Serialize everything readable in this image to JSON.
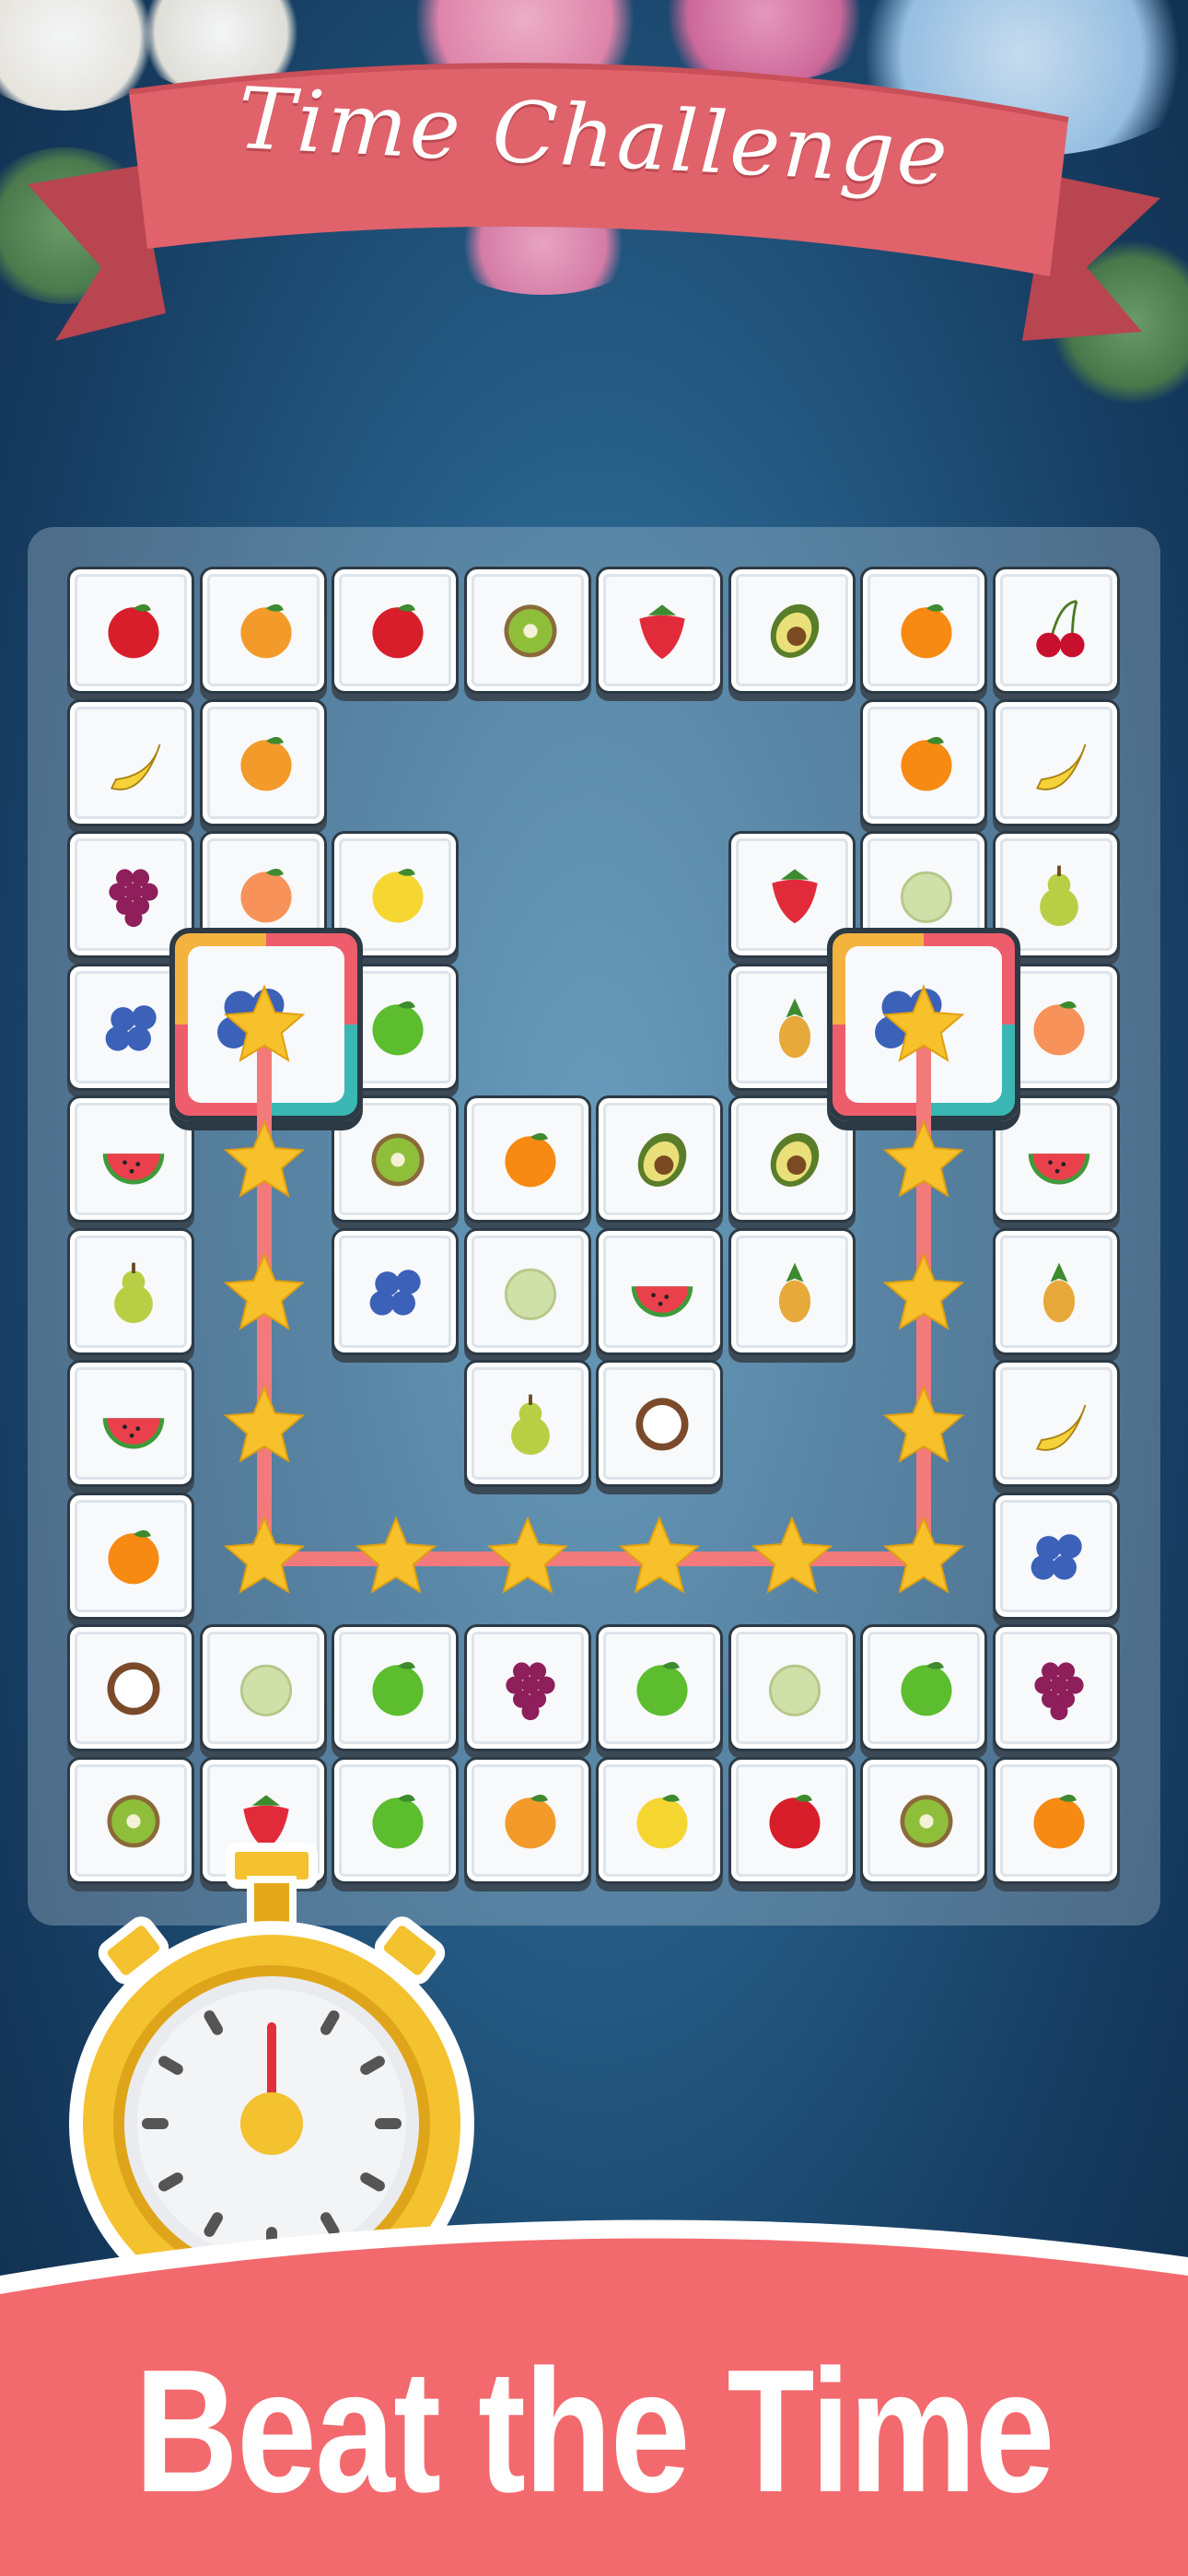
{
  "banner": {
    "title": "Time Challenge",
    "color": "#e0636b"
  },
  "tagline": {
    "text": "Beat the Time",
    "band_color": "#f26a6e"
  },
  "palette": {
    "path": "#f27a7a",
    "star": "#f6c12b",
    "timer": "#f4c12f"
  },
  "board": {
    "rows": [
      [
        "apple",
        "mango",
        "apple",
        "kiwi",
        "strawberry",
        "avocado",
        "orange",
        "cherry"
      ],
      [
        "banana",
        "mango",
        null,
        null,
        null,
        null,
        "orange",
        "banana"
      ],
      [
        "grapes",
        "peach",
        "lemon",
        null,
        null,
        "strawberry",
        "melon",
        "pear"
      ],
      [
        "blueberry",
        "blueberry",
        "apple-green",
        null,
        null,
        "pineapple",
        "blueberry",
        "peach"
      ],
      [
        "watermelon",
        null,
        "kiwi",
        "orange",
        "avocado",
        "avocado",
        null,
        "watermelon"
      ],
      [
        "pear",
        null,
        "blueberry",
        "melon",
        "watermelon",
        "pineapple",
        null,
        "pineapple"
      ],
      [
        "watermelon",
        null,
        null,
        "pear",
        "coconut",
        null,
        null,
        "banana"
      ],
      [
        "orange",
        null,
        null,
        null,
        null,
        null,
        null,
        "blueberry"
      ],
      [
        "coconut",
        "melon",
        "apple-green",
        "grapes",
        "apple-green",
        "melon",
        "apple-green",
        "grapes"
      ],
      [
        "kiwi",
        "strawberry",
        "apple-green",
        "mango",
        "lemon",
        "apple",
        "kiwi",
        "orange"
      ]
    ],
    "selected": [
      {
        "fruit": "blueberry",
        "row": 3,
        "col": 1
      },
      {
        "fruit": "blueberry",
        "row": 3,
        "col": 6
      }
    ]
  },
  "fruit_colors": {
    "apple": "#d81e2a",
    "apple-green": "#5cbd2e",
    "mango": "#f29b2a",
    "kiwi": "#8fbf3a",
    "strawberry": "#e22b3a",
    "avocado": "#5a7d2a",
    "orange": "#f68a12",
    "cherry": "#c8102e",
    "banana": "#f6d23a",
    "grapes": "#8e1f5a",
    "peach": "#f7935a",
    "lemon": "#f6d631",
    "melon": "#cfe0a9",
    "pear": "#b8cf45",
    "blueberry": "#3c61b8",
    "pineapple": "#e7a93a",
    "watermelon": "#e9404c",
    "coconut": "#7a4a2a"
  }
}
